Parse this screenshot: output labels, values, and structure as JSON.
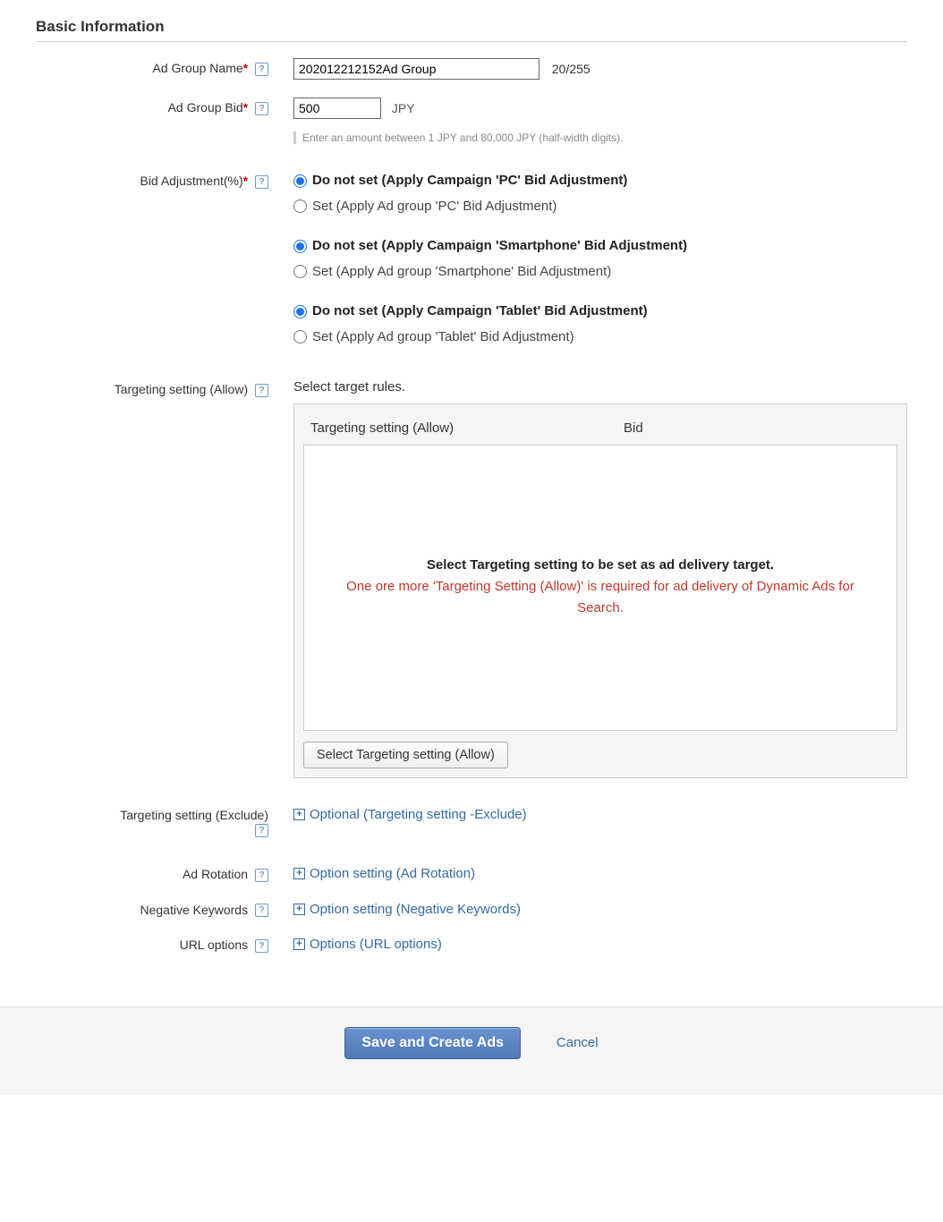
{
  "section_title": "Basic Information",
  "labels": {
    "ad_group_name": "Ad Group Name",
    "ad_group_bid": "Ad Group Bid",
    "bid_adjustment": "Bid Adjustment(%)",
    "targeting_allow": "Targeting setting (Allow)",
    "targeting_exclude": "Targeting setting (Exclude)",
    "ad_rotation": "Ad Rotation",
    "negative_keywords": "Negative Keywords",
    "url_options": "URL options"
  },
  "ad_group_name": {
    "value": "202012212152Ad Group",
    "counter": "20/255"
  },
  "ad_group_bid": {
    "value": "500",
    "currency": "JPY",
    "helptext": "Enter an amount between 1 JPY and 80,000 JPY (half-width digits)."
  },
  "bid_adjustment": {
    "groups": [
      {
        "device": "PC",
        "opt_do_not_set": "Do not set (Apply Campaign 'PC' Bid Adjustment)",
        "opt_set": "Set (Apply Ad group 'PC' Bid Adjustment)"
      },
      {
        "device": "Smartphone",
        "opt_do_not_set": "Do not set (Apply Campaign 'Smartphone' Bid Adjustment)",
        "opt_set": "Set (Apply Ad group 'Smartphone' Bid Adjustment)"
      },
      {
        "device": "Tablet",
        "opt_do_not_set": "Do not set (Apply Campaign 'Tablet' Bid Adjustment)",
        "opt_set": "Set (Apply Ad group 'Tablet' Bid Adjustment)"
      }
    ]
  },
  "targeting": {
    "intro": "Select target rules.",
    "col_allow": "Targeting setting (Allow)",
    "col_bid": "Bid",
    "msg_bold": "Select Targeting setting to be set as ad delivery target.",
    "msg_red": "One ore more 'Targeting Setting (Allow)' is required for ad delivery of Dynamic Ads for Search.",
    "select_button": "Select Targeting setting (Allow)"
  },
  "expandables": {
    "exclude": "Optional (Targeting setting -Exclude)",
    "rotation": "Option setting (Ad Rotation)",
    "negative": "Option setting (Negative Keywords)",
    "url": "Options (URL options)"
  },
  "footer": {
    "save": "Save and Create Ads",
    "cancel": "Cancel"
  }
}
